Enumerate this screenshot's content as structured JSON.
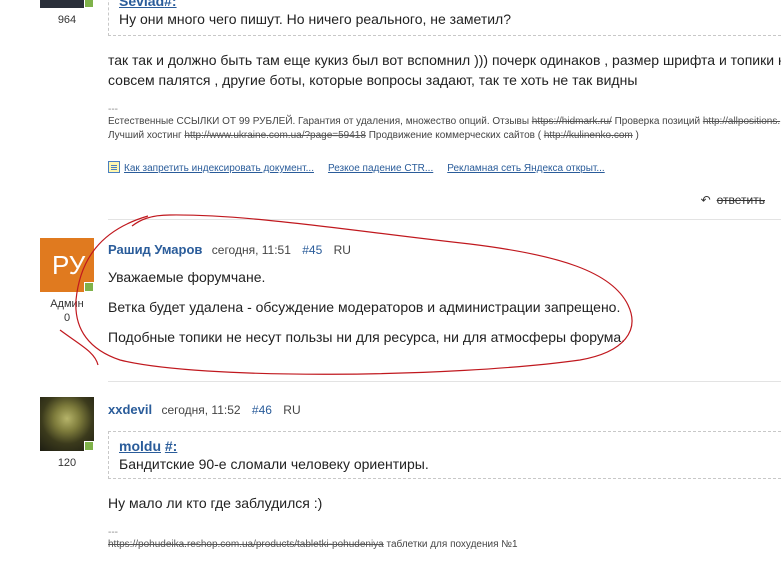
{
  "top_post": {
    "post_count": "964",
    "quote_author": "Sevlad",
    "quote_hash": "#:",
    "quote_text": "Ну они много чего пишут. Но ничего реального, не заметил?",
    "body_line1": "так так и должно быть там еще кукиз был вот вспомнил ))) почерк одинаков , размер шрифта и топики не о ч",
    "body_line2": "совсем палятся , другие боты, которые вопросы задают, так  те хоть не так видны",
    "sig_sep": "---",
    "sig_line1_text": "Естественные ССЫЛКИ ОТ 99 РУБЛЕЙ. Гарантия от удаления, множество опций. Отзывы ",
    "sig_line1_link1": "https://hidmark.ru/",
    "sig_line1_mid": " Проверка позиций ",
    "sig_line1_link2": "http://allpositions.",
    "sig_line2_text": "Лучший хостинг ",
    "sig_line2_link1": "http://www.ukraine.com.ua/?page=59418",
    "sig_line2_mid": " Продвижение коммерческих сайтов ( ",
    "sig_line2_link2": "http://kulinenko.com",
    "sig_line2_end": " )",
    "related": [
      "Как запретить индексировать документ...",
      "Резкое падение CTR...",
      "Рекламная сеть Яндекса открыт..."
    ],
    "reply_label": "ответить"
  },
  "post45": {
    "avatar_letters": "РУ",
    "role": "Админ",
    "role_count": "0",
    "user": "Рашид Умаров",
    "time": "сегодня, 11:51",
    "num": "#45",
    "lang": "RU",
    "lines": [
      "Уважаемые форумчане.",
      "Ветка будет удалена - обсуждение модераторов и администрации запрещено.",
      "Подобные топики не несут пользы ни для ресурса, ни для атмосферы форума."
    ]
  },
  "post46": {
    "post_count": "120",
    "user": "xxdevil",
    "time": "сегодня, 11:52",
    "num": "#46",
    "lang": "RU",
    "quote_author": "moldu",
    "quote_hash": "#:",
    "quote_text": "Бандитские 90-е сломали человеку ориентиры.",
    "body": "Ну мало ли кто где заблудился :)",
    "sig_sep": "---",
    "sig_link": "https://pohudeika.reshop.com.ua/products/tabletki-pohudeniya",
    "sig_text": " таблетки для похудения №1"
  },
  "colors": {
    "accent": "#2a5c9a",
    "avatar_orange": "#e07a1f",
    "online": "#7fb24a",
    "annotation": "#c0181e"
  }
}
